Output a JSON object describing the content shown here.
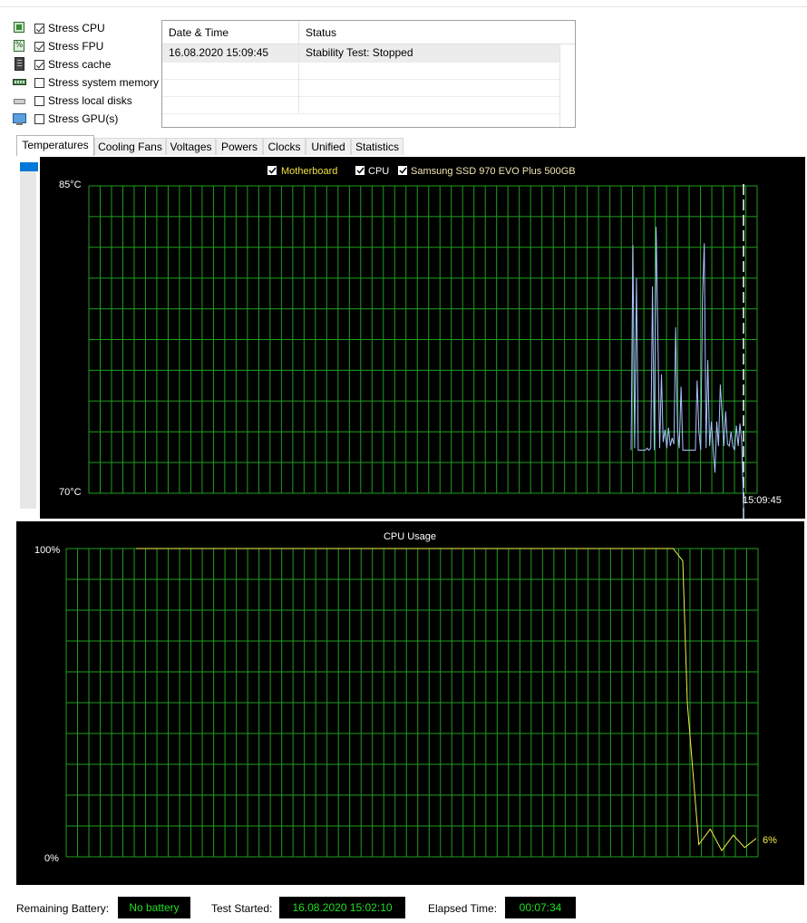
{
  "stress": [
    {
      "label": "Stress CPU",
      "checked": true,
      "icon": "cpu-chip-icon"
    },
    {
      "label": "Stress FPU",
      "checked": true,
      "icon": "fpu-icon"
    },
    {
      "label": "Stress cache",
      "checked": true,
      "icon": "cache-chip-icon"
    },
    {
      "label": "Stress system memory",
      "checked": false,
      "icon": "memory-module-icon"
    },
    {
      "label": "Stress local disks",
      "checked": false,
      "icon": "disk-drive-icon"
    },
    {
      "label": "Stress GPU(s)",
      "checked": false,
      "icon": "gpu-monitor-icon"
    }
  ],
  "status_table": {
    "headers": {
      "date": "Date & Time",
      "status": "Status"
    },
    "rows": [
      {
        "date": "16.08.2020 15:09:45",
        "status": "Stability Test: Stopped"
      }
    ]
  },
  "tabs": [
    "Temperatures",
    "Cooling Fans",
    "Voltages",
    "Powers",
    "Clocks",
    "Unified",
    "Statistics"
  ],
  "active_tab": "Temperatures",
  "colors": {
    "grid": "#1f9e1f",
    "motherboard_legend": "#f2e040",
    "cpu_legend": "#ffffff",
    "ssd_legend": "#f2e6b0",
    "cpu_line": "#a8c4ff",
    "usage_line": "#f2f24a",
    "value_text": "#1fe01f"
  },
  "chart_data": [
    {
      "type": "line",
      "title": "",
      "legend": [
        "Motherboard",
        "CPU",
        "Samsung SSD 970 EVO Plus 500GB"
      ],
      "legend_checked": [
        true,
        true,
        true
      ],
      "y_top_label": "85°C",
      "y_bottom_label": "70°C",
      "ylim": [
        70,
        85
      ],
      "x_end_label": "15:09:45",
      "grid": true,
      "series": [
        {
          "name": "CPU",
          "x": [
            0,
            1,
            2,
            3,
            4,
            5,
            6,
            7,
            8,
            9,
            10,
            11,
            12,
            13,
            14,
            15,
            16,
            17,
            18,
            19,
            20,
            21,
            22,
            23,
            24,
            25,
            26,
            27,
            28,
            29,
            30,
            31,
            32,
            33,
            34,
            35,
            36,
            37,
            38,
            39,
            40,
            41,
            42,
            43,
            44,
            45,
            46,
            47,
            48,
            49,
            50,
            51,
            52,
            53,
            54,
            55,
            56,
            57,
            58,
            59,
            60,
            61,
            62,
            63
          ],
          "y": [
            72.1,
            82.1,
            72.2,
            80.5,
            72.1,
            72.1,
            72.1,
            72.1,
            72.1,
            72.2,
            72.1,
            72.2,
            80.1,
            72.1,
            83.0,
            77.8,
            72.2,
            75.8,
            72.5,
            73.1,
            72.2,
            73.2,
            72.3,
            72.7,
            72.4,
            78.1,
            73.1,
            72.2,
            75.2,
            72.1,
            72.1,
            72.1,
            72.1,
            72.1,
            72.1,
            72.1,
            72.1,
            75.5,
            73.0,
            72.1,
            79.5,
            82.2,
            72.2,
            76.5,
            72.3,
            73.5,
            72.2,
            71.0,
            73.5,
            72.3,
            75.3,
            73.8,
            72.3,
            74.0,
            72.4,
            72.3,
            73.0,
            72.3,
            72.1,
            73.3,
            72.3,
            73.4,
            72.5,
            69.3
          ]
        }
      ]
    },
    {
      "type": "line",
      "title": "CPU Usage",
      "y_top_label": "100%",
      "y_bottom_label": "0%",
      "ylim": [
        0,
        100
      ],
      "last_value_label": "6%",
      "grid": true,
      "series": [
        {
          "name": "",
          "x": [
            0,
            1,
            2,
            3,
            4,
            5,
            6,
            7,
            8,
            9,
            10,
            11,
            12,
            13,
            14,
            15,
            16,
            17,
            18,
            19,
            20,
            21,
            22,
            23,
            24,
            25,
            26,
            27,
            28,
            29,
            30,
            31,
            32,
            33,
            34,
            35,
            36,
            37,
            38,
            39,
            40,
            41,
            42,
            43,
            44,
            45,
            46,
            47,
            48,
            49,
            50,
            51,
            52,
            53,
            54,
            55,
            56,
            57,
            58,
            59,
            60,
            61,
            62,
            63,
            64
          ],
          "y": [
            100,
            100,
            100,
            100,
            100,
            100,
            100,
            100,
            100,
            100,
            100,
            100,
            100,
            100,
            100,
            100,
            100,
            100,
            100,
            100,
            100,
            100,
            100,
            100,
            100,
            100,
            100,
            100,
            100,
            100,
            100,
            100,
            100,
            100,
            100,
            100,
            100,
            100,
            100,
            100,
            100,
            100,
            100,
            100,
            100,
            100,
            100,
            100,
            100,
            100,
            100,
            100,
            100,
            100,
            100,
            100,
            100,
            96,
            50,
            4,
            9,
            2,
            7,
            3,
            6
          ]
        }
      ]
    }
  ],
  "bottom_bar": {
    "battery_label": "Remaining Battery:",
    "battery_value": "No battery",
    "started_label": "Test Started:",
    "started_value": "16.08.2020 15:02:10",
    "elapsed_label": "Elapsed Time:",
    "elapsed_value": "00:07:34"
  }
}
